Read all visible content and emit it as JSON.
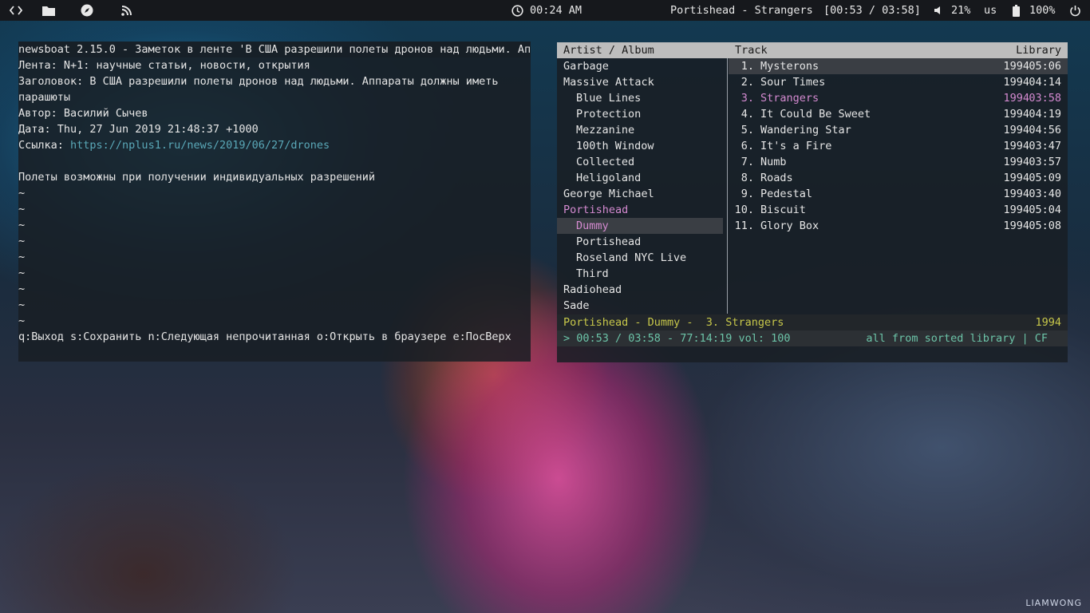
{
  "topbar": {
    "icons": [
      "code-icon",
      "folder-icon",
      "compass-icon",
      "rss-icon"
    ],
    "clock": "00:24 AM",
    "now_playing": "Portishead - Strangers",
    "progress": "[00:53 / 03:58]",
    "volume": "21%",
    "layout": "us",
    "battery": "100%"
  },
  "newsboat": {
    "lines": [
      "newsboat 2.15.0 - Заметок в ленте 'В США разрешили полеты дронов над людьми. Апп",
      "Лента: N+1: научные статьи, новости, открытия",
      "Заголовок: В США разрешили полеты дронов над людьми. Аппараты должны иметь",
      "парашюты",
      "Автор: Василий Сычев",
      "Дата: Thu, 27 Jun 2019 21:48:37 +1000"
    ],
    "link_label": "Ссылка: ",
    "link_url": "https://nplus1.ru/news/2019/06/27/drones",
    "body": "Полеты возможны при получении индивидуальных разрешений",
    "tilde": "~",
    "help": "q:Выход s:Сохранить n:Следующая непрочитанная o:Открыть в браузере e:ПосВерх"
  },
  "cmus": {
    "header": {
      "left": "Artist / Album",
      "mid": "Track",
      "right": "Library"
    },
    "artists": [
      {
        "text": "Garbage",
        "indent": false
      },
      {
        "text": "Massive Attack",
        "indent": false
      },
      {
        "text": "Blue Lines",
        "indent": true
      },
      {
        "text": "Protection",
        "indent": true
      },
      {
        "text": "Mezzanine",
        "indent": true
      },
      {
        "text": "100th Window",
        "indent": true
      },
      {
        "text": "Collected",
        "indent": true
      },
      {
        "text": "Heligoland",
        "indent": true
      },
      {
        "text": "George Michael",
        "indent": false
      },
      {
        "text": "Portishead",
        "indent": false,
        "active": true
      },
      {
        "text": "Dummy",
        "indent": true,
        "selected": true
      },
      {
        "text": "Portishead",
        "indent": true
      },
      {
        "text": "Roseland NYC Live",
        "indent": true
      },
      {
        "text": "Third",
        "indent": true
      },
      {
        "text": "Radiohead",
        "indent": false
      },
      {
        "text": "Sade",
        "indent": false
      }
    ],
    "tracks": [
      {
        "num": "1.",
        "title": "Mysterons",
        "year": "1994",
        "dur": "05:06",
        "selected": true
      },
      {
        "num": "2.",
        "title": "Sour Times",
        "year": "1994",
        "dur": "04:14"
      },
      {
        "num": "3.",
        "title": "Strangers",
        "year": "1994",
        "dur": "03:58",
        "playing": true
      },
      {
        "num": "4.",
        "title": "It Could Be Sweet",
        "year": "1994",
        "dur": "04:19"
      },
      {
        "num": "5.",
        "title": "Wandering Star",
        "year": "1994",
        "dur": "04:56"
      },
      {
        "num": "6.",
        "title": "It's a Fire",
        "year": "1994",
        "dur": "03:47"
      },
      {
        "num": "7.",
        "title": "Numb",
        "year": "1994",
        "dur": "03:57"
      },
      {
        "num": "8.",
        "title": "Roads",
        "year": "1994",
        "dur": "05:09"
      },
      {
        "num": "9.",
        "title": "Pedestal",
        "year": "1994",
        "dur": "03:40"
      },
      {
        "num": "10.",
        "title": "Biscuit",
        "year": "1994",
        "dur": "05:04"
      },
      {
        "num": "11.",
        "title": "Glory Box",
        "year": "1994",
        "dur": "05:08"
      }
    ],
    "status_track": "Portishead - Dummy -  3. Strangers",
    "status_year": "1994",
    "status_pos": "> 00:53 / 03:58 - 77:14:19 vol: 100",
    "status_mode": "all from sorted library | CF"
  },
  "watermark": "LIAMWONG"
}
